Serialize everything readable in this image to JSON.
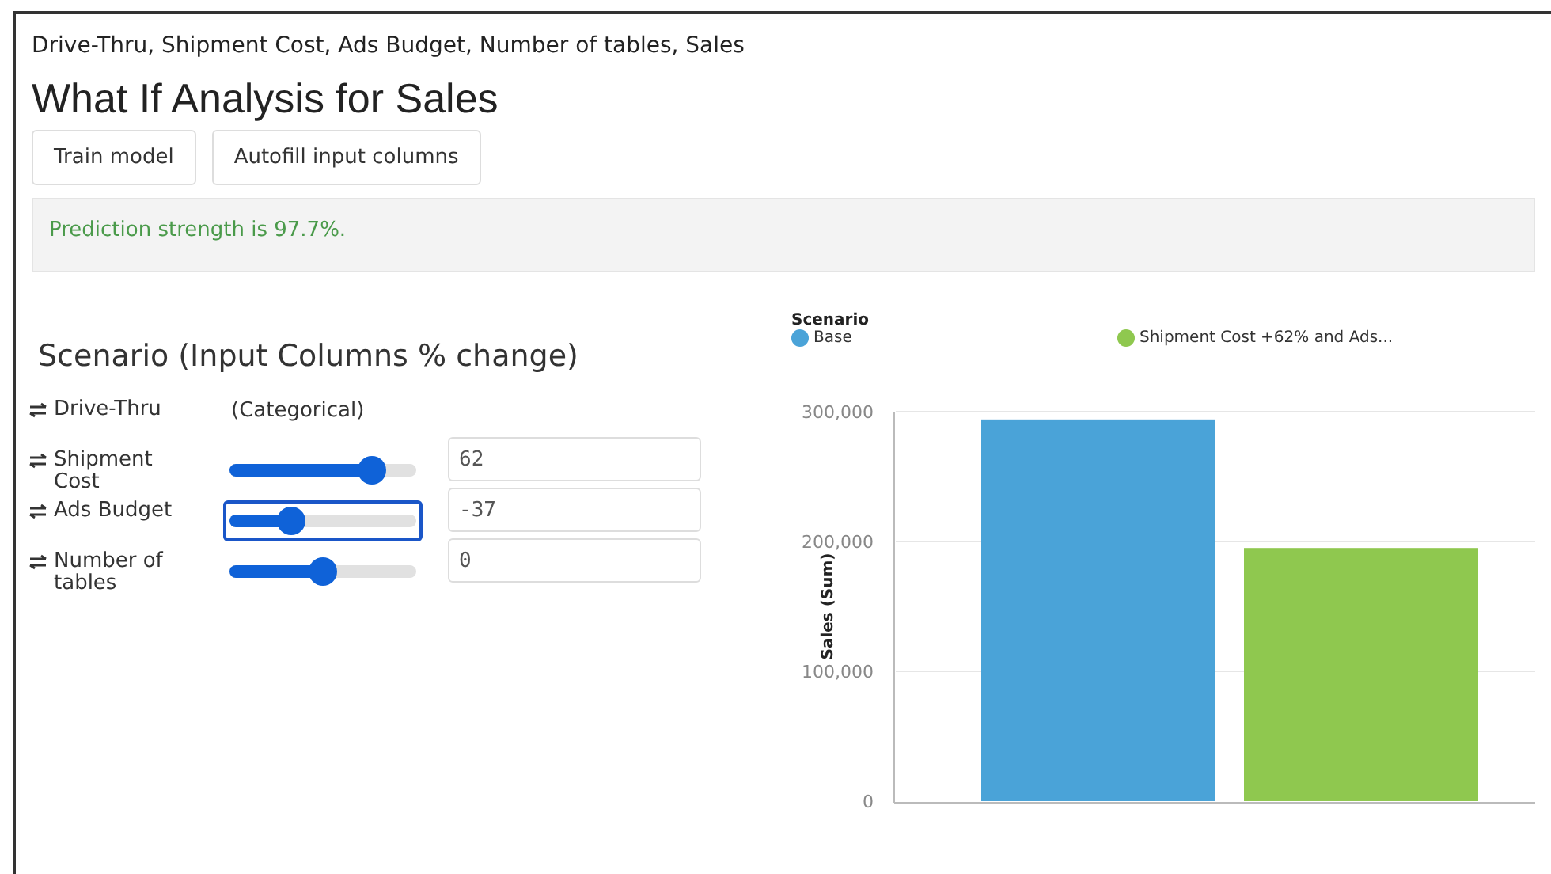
{
  "columns_line": "Drive-Thru, Shipment Cost, Ads Budget, Number of tables, Sales",
  "title": "What If Analysis for Sales",
  "buttons": [
    "Train model",
    "Autofill input columns"
  ],
  "message": "Prediction strength is 97.7%.",
  "scenario": {
    "title": "Scenario (Input Columns % change)",
    "rows": [
      {
        "kind": "categorical",
        "label": "Drive-Thru",
        "note": "(Categorical)"
      },
      {
        "kind": "slider",
        "label": "Shipment Cost",
        "level": 0.76,
        "value": "62",
        "focused": false
      },
      {
        "kind": "slider",
        "label": "Ads Budget",
        "level": 0.33,
        "value": "-37",
        "focused": true
      },
      {
        "kind": "slider",
        "label": "Number of tables",
        "level": 0.5,
        "value": "0",
        "focused": false
      }
    ]
  },
  "chart": {
    "legend_title": "Scenario",
    "chart_data": {
      "type": "bar",
      "ylabel": "Sales (Sum)",
      "series": [
        {
          "name": "Base",
          "color": "#4aa3d8",
          "values": [
            294000
          ]
        },
        {
          "name": "Shipment Cost +62% and Ads...",
          "color": "#8fc84f",
          "values": [
            195000
          ]
        }
      ],
      "ylim": [
        0,
        300000
      ],
      "yticks": [
        {
          "value": 0,
          "label": "0"
        },
        {
          "value": 100000,
          "label": "100,000"
        },
        {
          "value": 200000,
          "label": "200,000"
        },
        {
          "value": 300000,
          "label": "300,000"
        }
      ]
    }
  }
}
